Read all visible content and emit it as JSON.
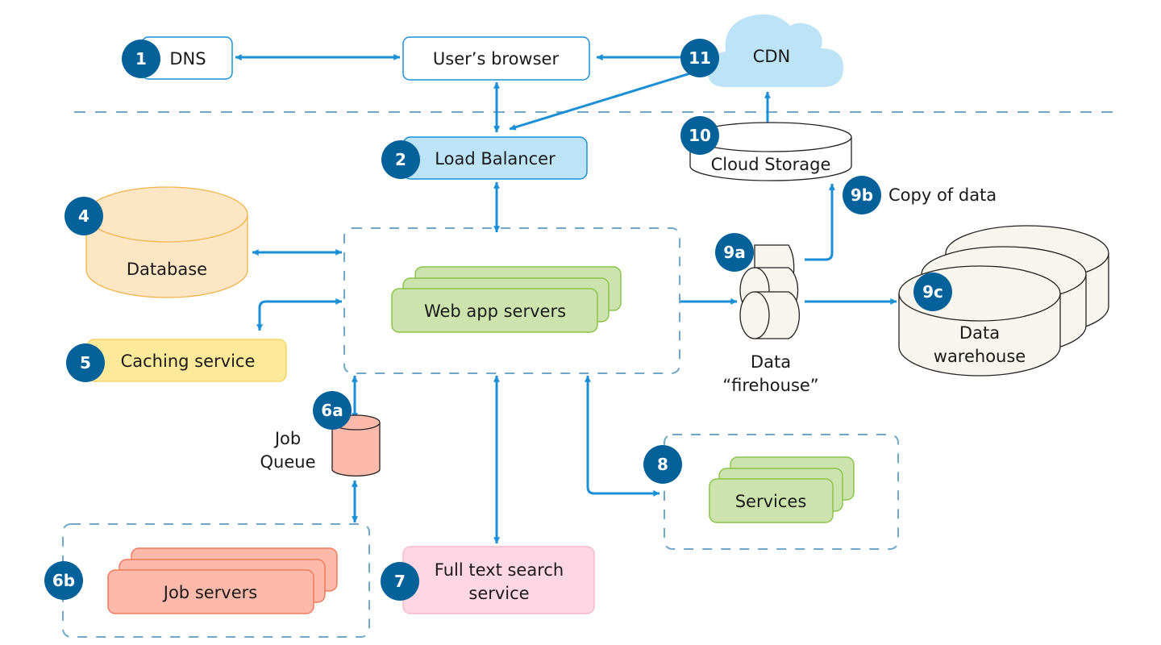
{
  "colors": {
    "badge": "#05619a",
    "arrow": "#1b8fd6",
    "dashed": "#6fa8c8",
    "lb_fill": "#bde3f7",
    "db_fill": "#fde6c3",
    "db_stroke": "#f0b44c",
    "cache_fill": "#fde99a",
    "green_fill": "#cde3ae",
    "green_stroke": "#8bc34a",
    "red_fill": "#fdb9a9",
    "red_stroke": "#f07a5e",
    "pink_fill": "#fed6e4",
    "pink_stroke": "#f7b9c8",
    "cloud_fill": "#bde3f7",
    "cylinder_fill": "#f8f5ee"
  },
  "nodes": {
    "dns": {
      "badge": "1",
      "label": "DNS"
    },
    "browser": {
      "label": "User’s browser"
    },
    "cdn": {
      "badge": "11",
      "label": "CDN"
    },
    "load_balancer": {
      "badge": "2",
      "label": "Load Balancer"
    },
    "cloud_storage": {
      "badge": "10",
      "label": "Cloud Storage"
    },
    "copy_of_data": {
      "badge": "9b",
      "label": "Copy of data"
    },
    "database": {
      "badge": "4",
      "label": "Database"
    },
    "web_app": {
      "label": "Web app servers"
    },
    "cache": {
      "badge": "5",
      "label": "Caching service"
    },
    "firehose": {
      "badge": "9a",
      "label_line1": "Data",
      "label_line2": "“firehouse”"
    },
    "warehouse": {
      "badge": "9c",
      "label_line1": "Data",
      "label_line2": "warehouse"
    },
    "job_queue": {
      "badge": "6a",
      "label_line1": "Job",
      "label_line2": "Queue"
    },
    "services": {
      "badge": "8",
      "label": "Services"
    },
    "job_servers": {
      "badge": "6b",
      "label": "Job servers"
    },
    "search": {
      "badge": "7",
      "label_line1": "Full text search",
      "label_line2": "service"
    }
  }
}
